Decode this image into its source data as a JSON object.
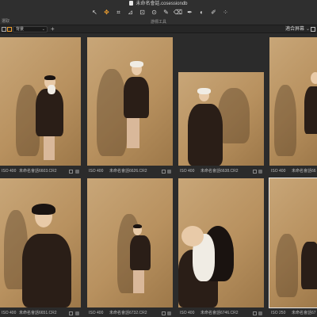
{
  "window": {
    "document_title": "未命名會話.cosessiondb",
    "tools_label": "游標工具",
    "left_label": "選取"
  },
  "toolbar": {
    "tools": [
      {
        "icon": "cursor-icon",
        "glyph": "↖",
        "active": false
      },
      {
        "icon": "pan-icon",
        "glyph": "✥",
        "active": true
      },
      {
        "icon": "crop-icon",
        "glyph": "⌗",
        "active": false
      },
      {
        "icon": "straighten-icon",
        "glyph": "⊿",
        "active": false
      },
      {
        "icon": "keystone-icon",
        "glyph": "⊡",
        "active": false
      },
      {
        "icon": "spot-icon",
        "glyph": "⊙",
        "active": false
      },
      {
        "icon": "brush-icon",
        "glyph": "✎",
        "active": false
      },
      {
        "icon": "eraser-icon",
        "glyph": "⌫",
        "active": false
      },
      {
        "icon": "picker-icon",
        "glyph": "✒",
        "active": false
      },
      {
        "icon": "gradient-icon",
        "glyph": "◐",
        "active": false
      },
      {
        "icon": "annotate-icon",
        "glyph": "✐",
        "active": false
      },
      {
        "icon": "text-icon",
        "glyph": "⁘",
        "active": false
      }
    ]
  },
  "subbar": {
    "filter_value": "背景",
    "fit_label": "適合屏幕"
  },
  "thumbnails": [
    {
      "iso": "ISO 400",
      "filename": "未命名會話6603.CR2"
    },
    {
      "iso": "ISO 400",
      "filename": "未命名會話6626.CR2"
    },
    {
      "iso": "ISO 400",
      "filename": "未命名會話6638.CR2"
    },
    {
      "iso": "ISO 400",
      "filename": "未命名會話66"
    },
    {
      "iso": "ISO 400",
      "filename": "未命名會話6651.CR2"
    },
    {
      "iso": "ISO 400",
      "filename": "未命名會話6732.CR2"
    },
    {
      "iso": "ISO 400",
      "filename": "未命名會話6746.CR2"
    },
    {
      "iso": "ISO 250",
      "filename": "未命名會話67"
    }
  ]
}
